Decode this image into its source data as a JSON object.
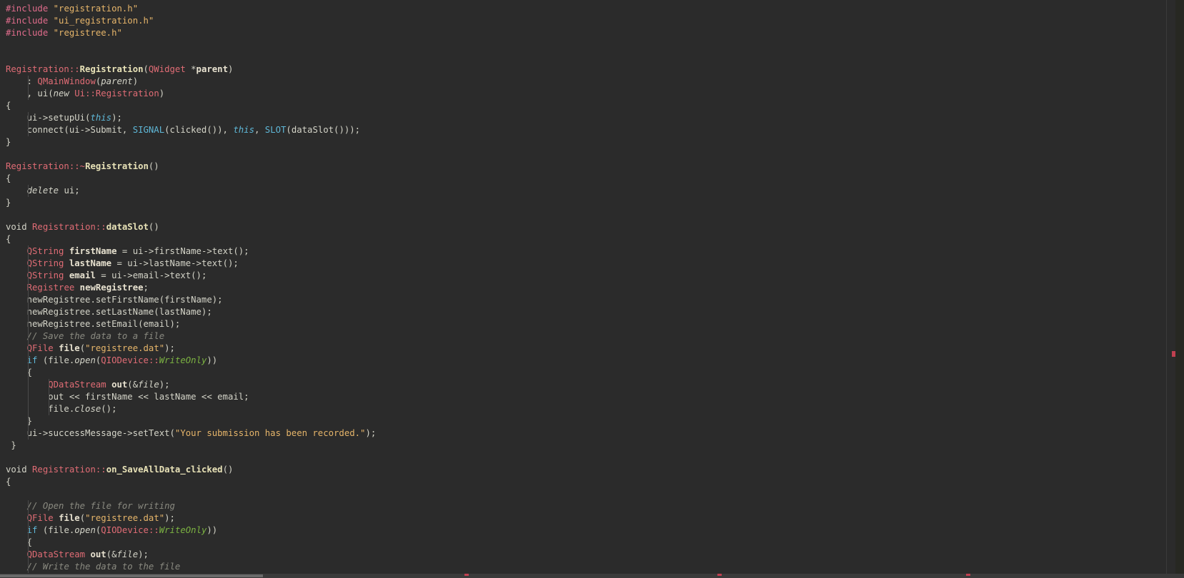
{
  "colors": {
    "background": "#2b2b2b",
    "preprocessor": "#e06c8c",
    "string": "#e6b56a",
    "type": "#e06c75",
    "keyword": "#5fb8d8",
    "comment": "#8a8a80",
    "enum": "#7cb342"
  },
  "lines": [
    [
      {
        "c": "t-pp",
        "t": "#include "
      },
      {
        "c": "t-str",
        "t": "\"registration.h\""
      }
    ],
    [
      {
        "c": "t-pp",
        "t": "#include "
      },
      {
        "c": "t-str",
        "t": "\"ui_registration.h\""
      }
    ],
    [
      {
        "c": "t-pp",
        "t": "#include "
      },
      {
        "c": "t-str",
        "t": "\"registree.h\""
      }
    ],
    [],
    [],
    [
      {
        "c": "t-type",
        "t": "Registration"
      },
      {
        "c": "t-op",
        "t": "::"
      },
      {
        "c": "t-fn",
        "t": "Registration"
      },
      {
        "c": "t-plain",
        "t": "("
      },
      {
        "c": "t-type",
        "t": "QWidget"
      },
      {
        "c": "t-plain",
        "t": " *"
      },
      {
        "c": "t-bold",
        "t": "parent"
      },
      {
        "c": "t-plain",
        "t": ")"
      }
    ],
    [
      {
        "c": "t-plain",
        "t": "    : "
      },
      {
        "c": "t-type",
        "t": "QMainWindow"
      },
      {
        "c": "t-plain",
        "t": "("
      },
      {
        "c": "t-it",
        "t": "parent"
      },
      {
        "c": "t-plain",
        "t": ")"
      }
    ],
    [
      {
        "c": "t-plain",
        "t": "    , ui("
      },
      {
        "c": "t-it",
        "t": "new"
      },
      {
        "c": "t-plain",
        "t": " "
      },
      {
        "c": "t-type",
        "t": "Ui"
      },
      {
        "c": "t-op",
        "t": "::"
      },
      {
        "c": "t-type",
        "t": "Registration"
      },
      {
        "c": "t-plain",
        "t": ")"
      }
    ],
    [
      {
        "c": "t-plain",
        "t": "{"
      }
    ],
    [
      {
        "c": "t-plain",
        "t": "    ui->setupUi("
      },
      {
        "c": "t-kwi",
        "t": "this"
      },
      {
        "c": "t-plain",
        "t": ");"
      }
    ],
    [
      {
        "c": "t-plain",
        "t": "    connect(ui->Submit, "
      },
      {
        "c": "t-kw",
        "t": "SIGNAL"
      },
      {
        "c": "t-plain",
        "t": "(clicked()), "
      },
      {
        "c": "t-kwi",
        "t": "this"
      },
      {
        "c": "t-plain",
        "t": ", "
      },
      {
        "c": "t-kw",
        "t": "SLOT"
      },
      {
        "c": "t-plain",
        "t": "(dataSlot()));"
      }
    ],
    [
      {
        "c": "t-plain",
        "t": "}"
      }
    ],
    [],
    [
      {
        "c": "t-type",
        "t": "Registration"
      },
      {
        "c": "t-op",
        "t": "::~"
      },
      {
        "c": "t-fn",
        "t": "Registration"
      },
      {
        "c": "t-plain",
        "t": "()"
      }
    ],
    [
      {
        "c": "t-plain",
        "t": "{"
      }
    ],
    [
      {
        "c": "t-plain",
        "t": "    "
      },
      {
        "c": "t-it",
        "t": "delete"
      },
      {
        "c": "t-plain",
        "t": " ui;"
      }
    ],
    [
      {
        "c": "t-plain",
        "t": "}"
      }
    ],
    [],
    [
      {
        "c": "t-plain",
        "t": "void "
      },
      {
        "c": "t-type",
        "t": "Registration"
      },
      {
        "c": "t-op",
        "t": "::"
      },
      {
        "c": "t-fn",
        "t": "dataSlot"
      },
      {
        "c": "t-plain",
        "t": "()"
      }
    ],
    [
      {
        "c": "t-plain",
        "t": "{"
      }
    ],
    [
      {
        "c": "t-plain",
        "t": "    "
      },
      {
        "c": "t-type",
        "t": "QString"
      },
      {
        "c": "t-plain",
        "t": " "
      },
      {
        "c": "t-bold",
        "t": "firstName"
      },
      {
        "c": "t-plain",
        "t": " = ui->firstName->text();"
      }
    ],
    [
      {
        "c": "t-plain",
        "t": "    "
      },
      {
        "c": "t-type",
        "t": "QString"
      },
      {
        "c": "t-plain",
        "t": " "
      },
      {
        "c": "t-bold",
        "t": "lastName"
      },
      {
        "c": "t-plain",
        "t": " = ui->lastName->text();"
      }
    ],
    [
      {
        "c": "t-plain",
        "t": "    "
      },
      {
        "c": "t-type",
        "t": "QString"
      },
      {
        "c": "t-plain",
        "t": " "
      },
      {
        "c": "t-bold",
        "t": "email"
      },
      {
        "c": "t-plain",
        "t": " = ui->email->text();"
      }
    ],
    [
      {
        "c": "t-plain",
        "t": "    "
      },
      {
        "c": "t-type",
        "t": "Registree"
      },
      {
        "c": "t-plain",
        "t": " "
      },
      {
        "c": "t-bold",
        "t": "newRegistree"
      },
      {
        "c": "t-plain",
        "t": ";"
      }
    ],
    [
      {
        "c": "t-plain",
        "t": "    newRegistree.setFirstName(firstName);"
      }
    ],
    [
      {
        "c": "t-plain",
        "t": "    newRegistree.setLastName(lastName);"
      }
    ],
    [
      {
        "c": "t-plain",
        "t": "    newRegistree.setEmail(email);"
      }
    ],
    [
      {
        "c": "t-plain",
        "t": "    "
      },
      {
        "c": "t-cm",
        "t": "// Save the data to a file"
      }
    ],
    [
      {
        "c": "t-plain",
        "t": "    "
      },
      {
        "c": "t-type",
        "t": "QFile"
      },
      {
        "c": "t-plain",
        "t": " "
      },
      {
        "c": "t-bold",
        "t": "file"
      },
      {
        "c": "t-plain",
        "t": "("
      },
      {
        "c": "t-str",
        "t": "\"registree.dat\""
      },
      {
        "c": "t-plain",
        "t": ");"
      }
    ],
    [
      {
        "c": "t-plain",
        "t": "    "
      },
      {
        "c": "t-kw",
        "t": "if"
      },
      {
        "c": "t-plain",
        "t": " (file."
      },
      {
        "c": "t-it",
        "t": "open"
      },
      {
        "c": "t-plain",
        "t": "("
      },
      {
        "c": "t-type",
        "t": "QIODevice"
      },
      {
        "c": "t-op",
        "t": "::"
      },
      {
        "c": "t-enum",
        "t": "WriteOnly"
      },
      {
        "c": "t-plain",
        "t": "))"
      }
    ],
    [
      {
        "c": "t-plain",
        "t": "    {"
      }
    ],
    [
      {
        "c": "t-plain",
        "t": "        "
      },
      {
        "c": "t-type",
        "t": "QDataStream"
      },
      {
        "c": "t-plain",
        "t": " "
      },
      {
        "c": "t-bold",
        "t": "out"
      },
      {
        "c": "t-plain",
        "t": "(&"
      },
      {
        "c": "t-it",
        "t": "file"
      },
      {
        "c": "t-plain",
        "t": ");"
      }
    ],
    [
      {
        "c": "t-plain",
        "t": "        out << firstName << lastName << email;"
      }
    ],
    [
      {
        "c": "t-plain",
        "t": "        file."
      },
      {
        "c": "t-it",
        "t": "close"
      },
      {
        "c": "t-plain",
        "t": "();"
      }
    ],
    [
      {
        "c": "t-plain",
        "t": "    }"
      }
    ],
    [
      {
        "c": "t-plain",
        "t": "    ui->successMessage->setText("
      },
      {
        "c": "t-str",
        "t": "\"Your submission has been recorded.\""
      },
      {
        "c": "t-plain",
        "t": ");"
      }
    ],
    [
      {
        "c": "t-plain",
        "t": " }"
      }
    ],
    [],
    [
      {
        "c": "t-plain",
        "t": "void "
      },
      {
        "c": "t-type",
        "t": "Registration"
      },
      {
        "c": "t-op",
        "t": "::"
      },
      {
        "c": "t-fn",
        "t": "on_SaveAllData_clicked"
      },
      {
        "c": "t-plain",
        "t": "()"
      }
    ],
    [
      {
        "c": "t-plain",
        "t": "{"
      }
    ],
    [],
    [
      {
        "c": "t-plain",
        "t": "    "
      },
      {
        "c": "t-cm",
        "t": "// Open the file for writing"
      }
    ],
    [
      {
        "c": "t-plain",
        "t": "    "
      },
      {
        "c": "t-type",
        "t": "QFile"
      },
      {
        "c": "t-plain",
        "t": " "
      },
      {
        "c": "t-bold",
        "t": "file"
      },
      {
        "c": "t-plain",
        "t": "("
      },
      {
        "c": "t-str",
        "t": "\"registree.dat\""
      },
      {
        "c": "t-plain",
        "t": ");"
      }
    ],
    [
      {
        "c": "t-plain",
        "t": "    "
      },
      {
        "c": "t-kw",
        "t": "if"
      },
      {
        "c": "t-plain",
        "t": " (file."
      },
      {
        "c": "t-it",
        "t": "open"
      },
      {
        "c": "t-plain",
        "t": "("
      },
      {
        "c": "t-type",
        "t": "QIODevice"
      },
      {
        "c": "t-op",
        "t": "::"
      },
      {
        "c": "t-enum",
        "t": "WriteOnly"
      },
      {
        "c": "t-plain",
        "t": "))"
      }
    ],
    [
      {
        "c": "t-plain",
        "t": "    {"
      }
    ],
    [
      {
        "c": "t-plain",
        "t": "    "
      },
      {
        "c": "t-type",
        "t": "QDataStream"
      },
      {
        "c": "t-plain",
        "t": " "
      },
      {
        "c": "t-bold",
        "t": "out"
      },
      {
        "c": "t-plain",
        "t": "(&"
      },
      {
        "c": "t-it",
        "t": "file"
      },
      {
        "c": "t-plain",
        "t": ");"
      }
    ],
    [
      {
        "c": "t-plain",
        "t": "    "
      },
      {
        "c": "t-cm",
        "t": "// Write the data to the file"
      }
    ]
  ]
}
